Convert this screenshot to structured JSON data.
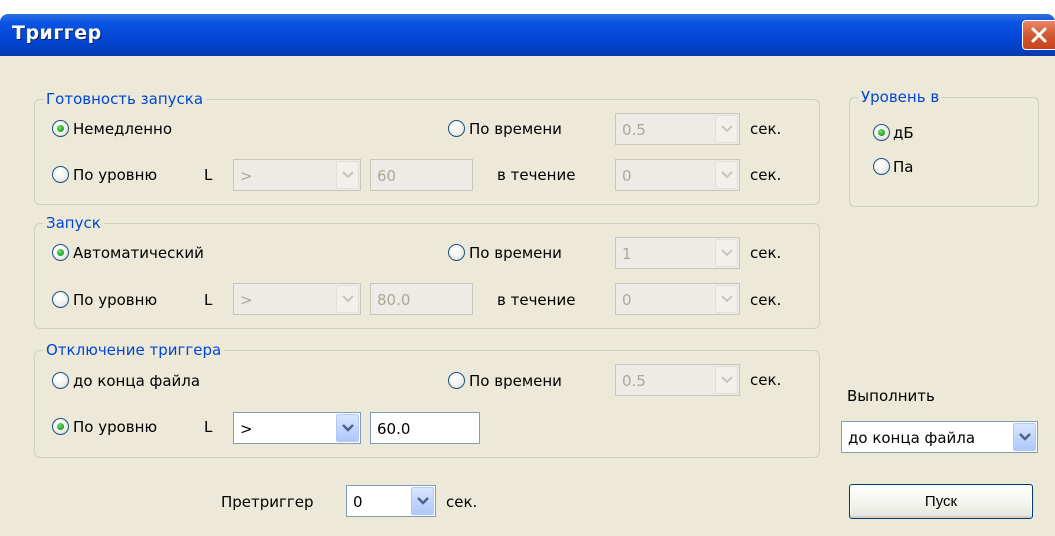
{
  "window": {
    "title": "Триггер"
  },
  "readiness": {
    "legend": "Готовность запуска",
    "immediate_label": "Немедленно",
    "by_time_label": "По времени",
    "by_time_value": "0.5",
    "sec1": "сек.",
    "by_level_label": "По уровню",
    "L": "L",
    "comparator": ">",
    "level_value": "60",
    "during_label": "в течение",
    "during_value": "0",
    "sec2": "сек."
  },
  "start": {
    "legend": "Запуск",
    "auto_label": "Автоматический",
    "by_time_label": "По времени",
    "by_time_value": "1",
    "sec1": "сек.",
    "by_level_label": "По уровню",
    "L": "L",
    "comparator": ">",
    "level_value": "80.0",
    "during_label": "в течение",
    "during_value": "0",
    "sec2": "сек."
  },
  "stop": {
    "legend": "Отключение триггера",
    "end_of_file_label": "до конца файла",
    "by_time_label": "По времени",
    "by_time_value": "0.5",
    "sec1": "сек.",
    "by_level_label": "По уровню",
    "L": "L",
    "comparator": ">",
    "level_value": "60.0"
  },
  "units": {
    "legend": "Уровень в",
    "db_label": "дБ",
    "pa_label": "Па"
  },
  "execute": {
    "label": "Выполнить",
    "value": "до конца файла"
  },
  "pretrigger": {
    "label": "Претриггер",
    "value": "0",
    "sec": "сек."
  },
  "start_button": {
    "label": "Пуск"
  }
}
